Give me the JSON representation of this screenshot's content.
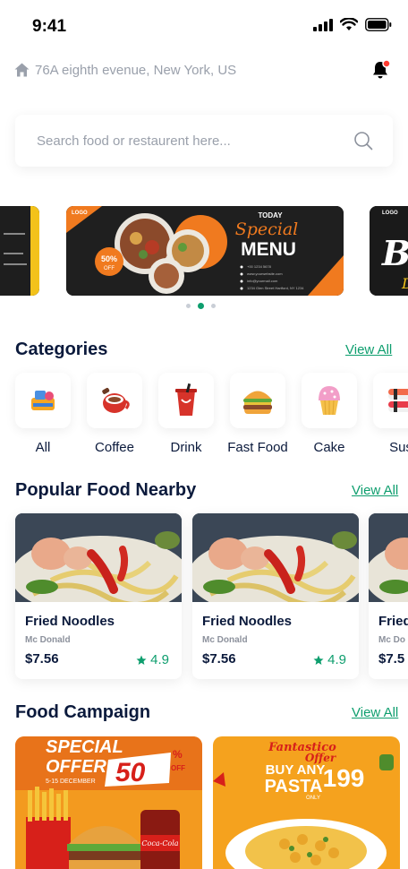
{
  "status_bar": {
    "time": "9:41"
  },
  "location": {
    "address": "76A eighth evenue, New York, US"
  },
  "search": {
    "placeholder": "Search food or restaurent here..."
  },
  "banner": {
    "brand": "LOGO",
    "today": "TODAY",
    "special": "Special",
    "menu": "MENU",
    "discount": "50%",
    "discount_sub": "OFF",
    "contact_lines": [
      "+00 1234 5678",
      "www.yourwebsite.com",
      "info@yourmail.com",
      "1234 Glen Street Hartford, NY 1234"
    ],
    "right_banner_text": "Be",
    "right_banner_sub": "D"
  },
  "categories": {
    "title": "Categories",
    "view_all": "View All",
    "items": [
      {
        "label": "All",
        "icon": "all-food-icon"
      },
      {
        "label": "Coffee",
        "icon": "coffee-icon"
      },
      {
        "label": "Drink",
        "icon": "drink-icon"
      },
      {
        "label": "Fast Food",
        "icon": "burger-icon"
      },
      {
        "label": "Cake",
        "icon": "cake-icon"
      },
      {
        "label": "Sus",
        "icon": "sushi-icon"
      }
    ]
  },
  "popular": {
    "title": "Popular Food Nearby",
    "view_all": "View All",
    "items": [
      {
        "name": "Fried Noodles",
        "restaurant": "Mc Donald",
        "price": "$7.56",
        "rating": "4.9"
      },
      {
        "name": "Fried Noodles",
        "restaurant": "Mc Donald",
        "price": "$7.56",
        "rating": "4.9"
      },
      {
        "name": "Fried",
        "restaurant": "Mc Do",
        "price": "$7.5",
        "rating": ""
      }
    ]
  },
  "campaign": {
    "title": "Food Campaign",
    "view_all": "View All",
    "left": {
      "line1": "SPECIAL",
      "line2": "OFFER",
      "discount": "50",
      "pct": "%",
      "off": "OFF",
      "dates": "5-15 DECEMBER",
      "brand": "Coca-Cola"
    },
    "right": {
      "line1": "Fantastico",
      "line2": "Offer",
      "line3": "BUY ANY",
      "line4": "PASTA",
      "price": "199",
      "only": "ONLY"
    }
  },
  "colors": {
    "accent": "#0e9e6e",
    "heading": "#0b1a3c",
    "muted": "#9aa0ab",
    "bell_dot": "#ff3b30"
  }
}
